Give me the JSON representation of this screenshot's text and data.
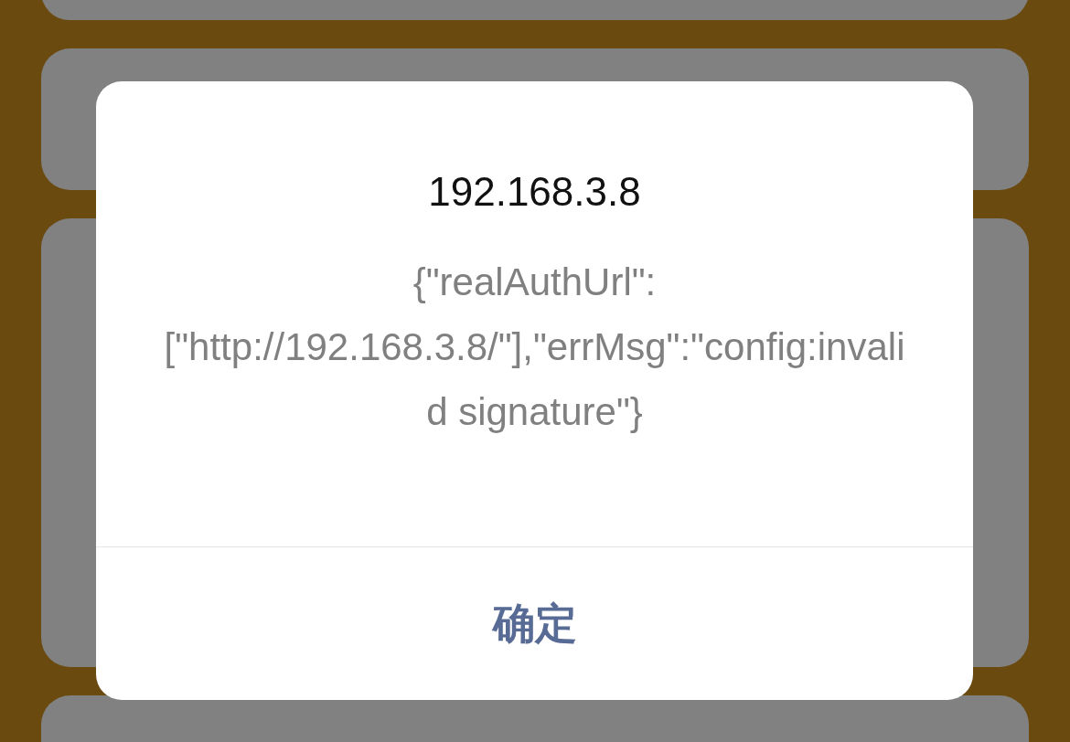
{
  "dialog": {
    "title": "192.168.3.8",
    "message": "{\"realAuthUrl\":[\"http://192.168.3.8/\"],\"errMsg\":\"config:invalid signature\"}",
    "buttons": [
      "确定"
    ]
  }
}
